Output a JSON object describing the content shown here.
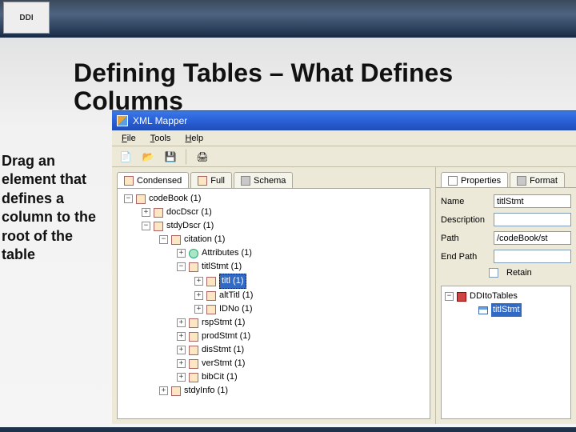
{
  "slide": {
    "title": "Defining Tables – What Defines Columns",
    "instruction": "Drag an element that defines a column to the root of the table"
  },
  "app": {
    "title": "XML Mapper",
    "menu": {
      "file": "File",
      "tools": "Tools",
      "help": "Help"
    },
    "left_tabs": {
      "condensed": "Condensed",
      "full": "Full",
      "schema": "Schema"
    },
    "right_tabs": {
      "properties": "Properties",
      "format": "Format"
    },
    "tree": {
      "root": "codeBook (1)",
      "docDscr": "docDscr (1)",
      "stdyDscr": "stdyDscr (1)",
      "citation": "citation (1)",
      "attributes": "Attributes (1)",
      "titlStmt": "titlStmt (1)",
      "titl": "titl (1)",
      "altTitl": "altTitl (1)",
      "idno": "IDNo (1)",
      "rspStmt": "rspStmt (1)",
      "prodStmt": "prodStmt (1)",
      "disStmt": "disStmt (1)",
      "verStmt": "verStmt (1)",
      "bibCit": "bibCit (1)",
      "stdyInfo": "stdyInfo (1)"
    },
    "props": {
      "name_label": "Name",
      "name_value": "titlStmt",
      "desc_label": "Description",
      "path_label": "Path",
      "path_value": "/codeBook/st",
      "endpath_label": "End Path",
      "retain_label": "Retain"
    },
    "map": {
      "root": "DDItoTables",
      "sel": "titlStmt"
    }
  }
}
